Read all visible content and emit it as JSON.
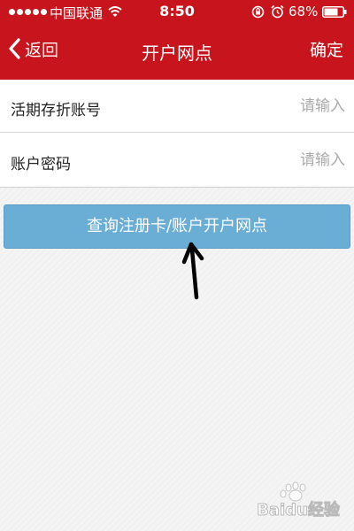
{
  "status_bar": {
    "carrier": "中国联通",
    "time": "8:50",
    "battery": "68%"
  },
  "nav": {
    "back_label": "返回",
    "title": "开户网点",
    "confirm_label": "确定"
  },
  "form": {
    "rows": [
      {
        "label": "活期存折账号",
        "placeholder": "请输入"
      },
      {
        "label": "账户密码",
        "placeholder": "请输入"
      }
    ]
  },
  "query_button": {
    "label": "查询注册卡/账户开户网点"
  },
  "watermark": {
    "text": "Baidu经验"
  },
  "colors": {
    "header": "#c8141c",
    "button": "#6aaed6"
  },
  "icons": [
    "signal-icon",
    "wifi-icon",
    "rotation-lock-icon",
    "alarm-icon",
    "battery-icon",
    "chevron-left-icon",
    "arrow-up-icon",
    "baidu-paw-icon"
  ]
}
